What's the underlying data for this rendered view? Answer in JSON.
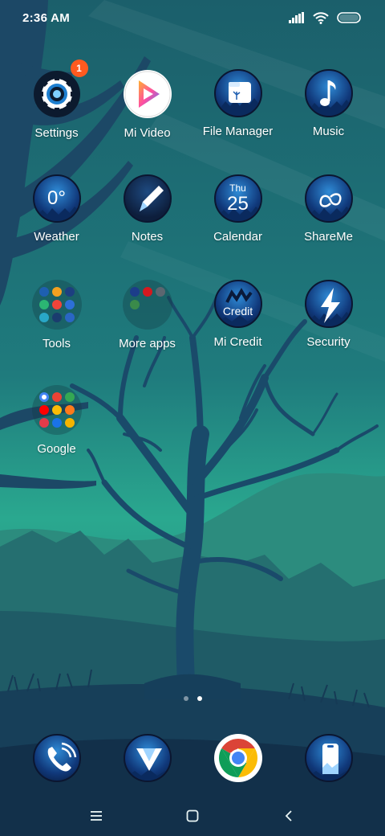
{
  "status_bar": {
    "time": "2:36 AM"
  },
  "apps": [
    {
      "label": "Settings",
      "icon": "settings-gear-icon",
      "badge": "1"
    },
    {
      "label": "Mi Video",
      "icon": "mi-video-play-icon"
    },
    {
      "label": "File Manager",
      "icon": "file-manager-icon"
    },
    {
      "label": "Music",
      "icon": "music-note-icon"
    },
    {
      "label": "Weather",
      "icon": "weather-icon",
      "icon_text": "0°"
    },
    {
      "label": "Notes",
      "icon": "notes-pen-icon"
    },
    {
      "label": "Calendar",
      "icon": "calendar-icon",
      "icon_day": "Thu",
      "icon_date": "25"
    },
    {
      "label": "ShareMe",
      "icon": "shareme-icon"
    },
    {
      "label": "Tools",
      "icon": "tools-folder-icon"
    },
    {
      "label": "More apps",
      "icon": "more-apps-folder-icon"
    },
    {
      "label": "Mi Credit",
      "icon": "mi-credit-icon",
      "icon_text": "Credit"
    },
    {
      "label": "Security",
      "icon": "security-bolt-icon"
    },
    {
      "label": "Google",
      "icon": "google-folder-icon"
    }
  ],
  "dock": [
    {
      "icon": "phone-icon"
    },
    {
      "icon": "messages-icon"
    },
    {
      "icon": "chrome-icon"
    },
    {
      "icon": "camera-icon"
    }
  ],
  "colors": {
    "badge": "#ff5a1f",
    "wallpaper_top": "#1b5f6b",
    "wallpaper_mid": "#2aa88f",
    "tree": "#1a4a6a"
  },
  "page_indicator": {
    "count": 2,
    "active": 2
  },
  "nav": {
    "menu": "menu-lines-icon",
    "home": "home-square-icon",
    "back": "back-chevron-icon"
  }
}
